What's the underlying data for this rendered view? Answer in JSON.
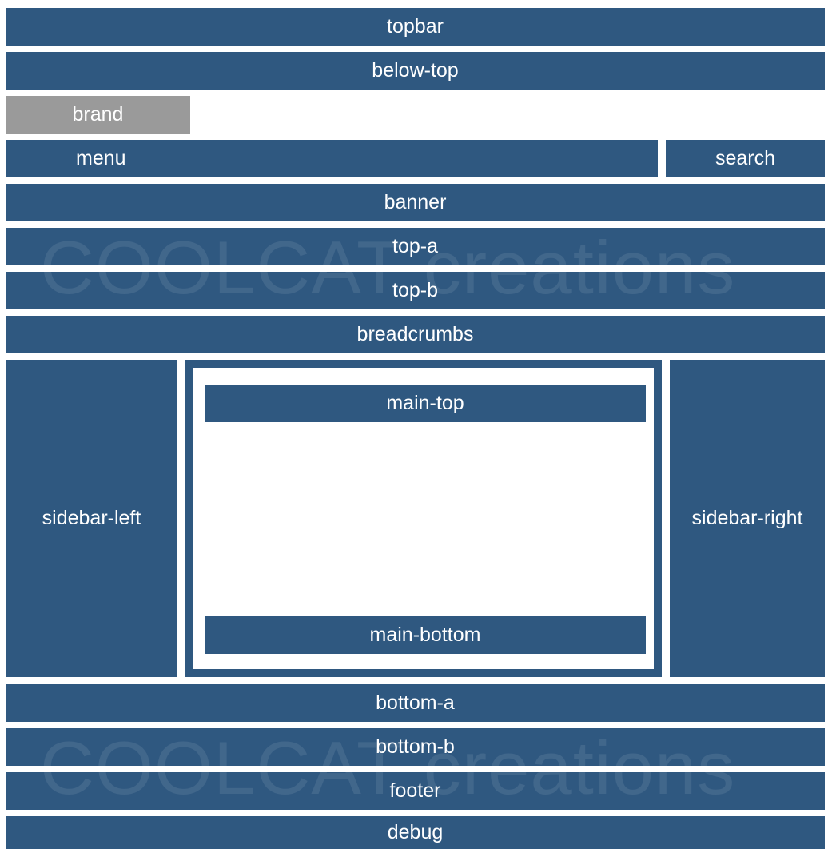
{
  "colors": {
    "block_blue": "#2f5880",
    "brand_grey": "#9a9a9a",
    "background": "#ffffff"
  },
  "positions": {
    "topbar": "topbar",
    "below_top": "below-top",
    "brand": "brand",
    "menu": "menu",
    "search": "search",
    "banner": "banner",
    "top_a": "top-a",
    "top_b": "top-b",
    "breadcrumbs": "breadcrumbs",
    "sidebar_left": "sidebar-left",
    "main_top": "main-top",
    "main_bottom": "main-bottom",
    "sidebar_right": "sidebar-right",
    "bottom_a": "bottom-a",
    "bottom_b": "bottom-b",
    "footer": "footer",
    "debug": "debug"
  },
  "watermark": {
    "text": "COOLCAT creations"
  }
}
